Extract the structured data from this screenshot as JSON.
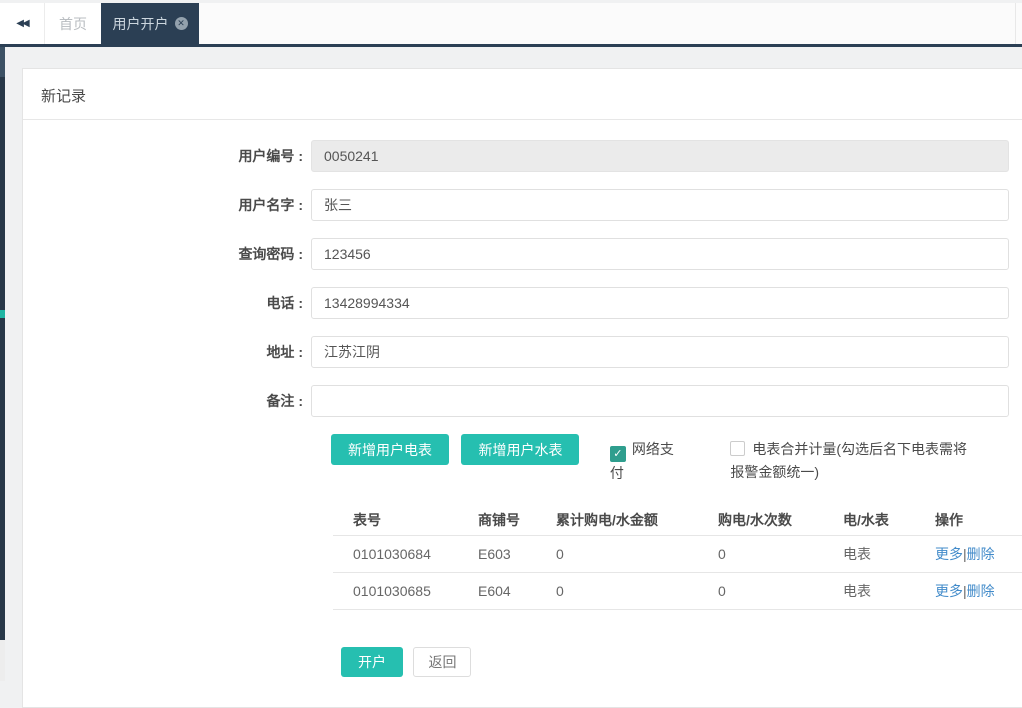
{
  "tabbar": {
    "collapse_icon": "◀◀",
    "home_tab": "首页",
    "active_tab": "用户开户",
    "close_icon": "✕"
  },
  "panel": {
    "title": "新记录"
  },
  "form": {
    "fields": [
      {
        "label": "用户编号 :",
        "value": "0050241",
        "disabled": true
      },
      {
        "label": "用户名字 :",
        "value": "张三"
      },
      {
        "label": "查询密码 :",
        "value": "123456"
      },
      {
        "label": "电话 :",
        "value": "13428994334"
      },
      {
        "label": "地址 :",
        "value": "江苏江阴"
      },
      {
        "label": "备注 :",
        "value": ""
      }
    ],
    "buttons": {
      "add_electric_meter": "新增用户电表",
      "add_water_meter": "新增用户水表"
    },
    "checkboxes": [
      {
        "label": "网络支付",
        "checked": true,
        "check_glyph": "✓"
      },
      {
        "label": "电表合并计量(勾选后名下电表需将报警金额统一)",
        "checked": false
      }
    ]
  },
  "table": {
    "headers": [
      "表号",
      "商铺号",
      "累计购电/水金额",
      "购电/水次数",
      "电/水表",
      "操作"
    ],
    "rows": [
      {
        "meter_no": "0101030684",
        "shop_no": "E603",
        "total_amount": "0",
        "purchase_count": "0",
        "meter_type": "电表",
        "op_more": "更多",
        "op_sep": "|",
        "op_delete": "删除"
      },
      {
        "meter_no": "0101030685",
        "shop_no": "E604",
        "total_amount": "0",
        "purchase_count": "0",
        "meter_type": "电表",
        "op_more": "更多",
        "op_sep": "|",
        "op_delete": "删除"
      }
    ]
  },
  "footer": {
    "submit": "开户",
    "back": "返回"
  },
  "colors": {
    "accent_teal": "#26bfb0",
    "checkbox_green": "#2f9e8e",
    "navy": "#2b3f54",
    "link_blue": "#428bca",
    "content_bg": "#f0f1f2"
  }
}
